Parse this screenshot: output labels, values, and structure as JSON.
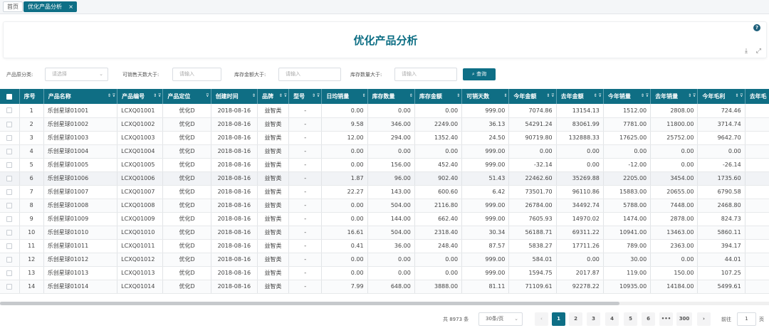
{
  "tabs": {
    "home": "首页",
    "active": "优化产品分析",
    "close": "×"
  },
  "page": {
    "title": "优化产品分析",
    "help": "?",
    "download": "⤓",
    "fullscreen": "⤢"
  },
  "filters": {
    "category_label": "产品原分类:",
    "category_placeholder": "请选择",
    "days_label": "可销售天数大于:",
    "days_placeholder": "请输入",
    "amount_label": "库存金额大于:",
    "amount_placeholder": "请输入",
    "qty_label": "库存数量大于:",
    "qty_placeholder": "请输入",
    "query_label": "查询"
  },
  "table": {
    "columns": [
      "序号",
      "产品名称",
      "产品编号",
      "产品定位",
      "创建时间",
      "品牌",
      "型号",
      "日均销量",
      "库存数量",
      "库存金额",
      "可销天数",
      "今年金额",
      "去年金额",
      "今年销量",
      "去年销量",
      "今年毛利",
      "去年毛"
    ],
    "rows": [
      [
        "1",
        "乐创星球01001",
        "LCXQ01001",
        "优化D",
        "2018-08-16",
        "益智类",
        "-",
        "0.00",
        "0.00",
        "0.00",
        "999.00",
        "7074.86",
        "13154.13",
        "1512.00",
        "2808.00",
        "724.46"
      ],
      [
        "2",
        "乐创星球01002",
        "LCXQ01002",
        "优化D",
        "2018-08-16",
        "益智类",
        "-",
        "9.58",
        "346.00",
        "2249.00",
        "36.13",
        "54291.24",
        "83061.99",
        "7781.00",
        "11800.00",
        "3714.74"
      ],
      [
        "3",
        "乐创星球01003",
        "LCXQ01003",
        "优化D",
        "2018-08-16",
        "益智类",
        "-",
        "12.00",
        "294.00",
        "1352.40",
        "24.50",
        "90719.80",
        "132888.33",
        "17625.00",
        "25752.00",
        "9642.70"
      ],
      [
        "4",
        "乐创星球01004",
        "LCXQ01004",
        "优化D",
        "2018-08-16",
        "益智类",
        "-",
        "0.00",
        "0.00",
        "0.00",
        "999.00",
        "0.00",
        "0.00",
        "0.00",
        "0.00",
        "0.00"
      ],
      [
        "5",
        "乐创星球01005",
        "LCXQ01005",
        "优化D",
        "2018-08-16",
        "益智类",
        "-",
        "0.00",
        "156.00",
        "452.40",
        "999.00",
        "-32.14",
        "0.00",
        "-12.00",
        "0.00",
        "-26.14"
      ],
      [
        "6",
        "乐创星球01006",
        "LCXQ01006",
        "优化D",
        "2018-08-16",
        "益智类",
        "-",
        "1.87",
        "96.00",
        "902.40",
        "51.43",
        "22462.60",
        "35269.88",
        "2205.00",
        "3454.00",
        "1735.60"
      ],
      [
        "7",
        "乐创星球01007",
        "LCXQ01007",
        "优化D",
        "2018-08-16",
        "益智类",
        "-",
        "22.27",
        "143.00",
        "600.60",
        "6.42",
        "73501.70",
        "96110.86",
        "15883.00",
        "20655.00",
        "6790.58"
      ],
      [
        "8",
        "乐创星球01008",
        "LCXQ01008",
        "优化D",
        "2018-08-16",
        "益智类",
        "-",
        "0.00",
        "504.00",
        "2116.80",
        "999.00",
        "26784.00",
        "34492.74",
        "5788.00",
        "7448.00",
        "2468.80"
      ],
      [
        "9",
        "乐创星球01009",
        "LCXQ01009",
        "优化D",
        "2018-08-16",
        "益智类",
        "-",
        "0.00",
        "144.00",
        "662.40",
        "999.00",
        "7605.93",
        "14970.02",
        "1474.00",
        "2878.00",
        "824.73"
      ],
      [
        "10",
        "乐创星球01010",
        "LCXQ01010",
        "优化D",
        "2018-08-16",
        "益智类",
        "-",
        "16.61",
        "504.00",
        "2318.40",
        "30.34",
        "56188.71",
        "69311.22",
        "10941.00",
        "13463.00",
        "5860.11"
      ],
      [
        "11",
        "乐创星球01011",
        "LCXQ01011",
        "优化D",
        "2018-08-16",
        "益智类",
        "-",
        "0.41",
        "36.00",
        "248.40",
        "87.57",
        "5838.27",
        "17711.26",
        "789.00",
        "2363.00",
        "394.17"
      ],
      [
        "12",
        "乐创星球01012",
        "LCXQ01012",
        "优化D",
        "2018-08-16",
        "益智类",
        "-",
        "0.00",
        "0.00",
        "0.00",
        "999.00",
        "584.01",
        "0.00",
        "30.00",
        "0.00",
        "44.01"
      ],
      [
        "13",
        "乐创星球01013",
        "LCXQ01013",
        "优化D",
        "2018-08-16",
        "益智类",
        "-",
        "0.00",
        "0.00",
        "0.00",
        "999.00",
        "1594.75",
        "2017.87",
        "119.00",
        "150.00",
        "107.25"
      ],
      [
        "14",
        "乐创星球01014",
        "LCXQ01014",
        "优化D",
        "2018-08-16",
        "益智类",
        "-",
        "7.99",
        "648.00",
        "3888.00",
        "81.11",
        "71109.61",
        "92278.22",
        "10935.00",
        "14184.00",
        "5499.61"
      ]
    ]
  },
  "pagination": {
    "total": "共 8973 条",
    "page_size": "30条/页",
    "prev": "‹",
    "pages": [
      "1",
      "2",
      "3",
      "4",
      "5",
      "6"
    ],
    "ellipsis": "•••",
    "last": "300",
    "next": "›",
    "goto_label": "前往",
    "goto_value": "1",
    "goto_suffix": "页"
  }
}
